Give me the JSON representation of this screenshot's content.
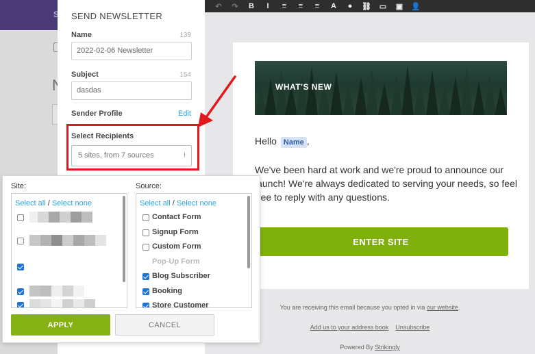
{
  "background": {
    "brand_partial": "S"
  },
  "toolbar": {
    "icons": [
      "undo-icon",
      "redo-icon",
      "bold-icon",
      "italic-icon",
      "align-left-icon",
      "align-center-icon",
      "align-right-icon",
      "text-style-icon",
      "color-dot-icon",
      "link-icon",
      "button-icon",
      "image-icon",
      "person-icon"
    ],
    "glyphs": [
      "↶",
      "↷",
      "B",
      "I",
      "≡",
      "≡",
      "≡",
      "A",
      "●",
      "⛓",
      "▭",
      "▣",
      "👤"
    ]
  },
  "panel": {
    "title": "SEND NEWSLETTER",
    "name_label": "Name",
    "name_count": "139",
    "name_value": "2022-02-06 Newsletter",
    "subject_label": "Subject",
    "subject_count": "154",
    "subject_value": "dasdas",
    "sender_label": "Sender Profile",
    "sender_edit": "Edit",
    "recipients_label": "Select Recipients",
    "recipients_value": "5 sites, from 7 sources"
  },
  "popup": {
    "site_label": "Site:",
    "source_label": "Source:",
    "select_all": "Select all",
    "separator": "/",
    "select_none": "Select none",
    "sites": [
      {
        "checked": false
      },
      {
        "checked": false
      },
      {
        "checked": true
      },
      {
        "checked": true
      },
      {
        "checked": true
      }
    ],
    "sources": [
      {
        "label": "Contact Form",
        "checked": false,
        "enabled": true
      },
      {
        "label": "Signup Form",
        "checked": false,
        "enabled": true
      },
      {
        "label": "Custom Form",
        "checked": false,
        "enabled": true
      },
      {
        "label": "Pop-Up Form",
        "checked": false,
        "enabled": false
      },
      {
        "label": "Blog Subscriber",
        "checked": true,
        "enabled": true
      },
      {
        "label": "Booking",
        "checked": true,
        "enabled": true
      },
      {
        "label": "Store Customer",
        "checked": true,
        "enabled": true
      }
    ],
    "apply_label": "APPLY",
    "cancel_label": "CANCEL"
  },
  "email": {
    "banner_title": "WHAT'S NEW",
    "hello": "Hello",
    "name_tag": "Name",
    "hello_comma": ",",
    "body": "We've been hard at work and we're proud to announce our launch! We're always dedicated to serving your needs, so feel free to reply with any questions.",
    "cta": "ENTER SITE",
    "footer_text": "You are receiving this email because you opted in via",
    "footer_link": "our website",
    "footer_period": ".",
    "address_book": "Add us to your address book",
    "unsubscribe": "Unsubscribe",
    "powered_by": "Powered By",
    "powered_brand": "Strikingly"
  },
  "colors": {
    "accent_green": "#86b113",
    "link_blue": "#2aa3d8",
    "highlight_red": "#e1181e",
    "checkbox_blue": "#1f74d8"
  }
}
